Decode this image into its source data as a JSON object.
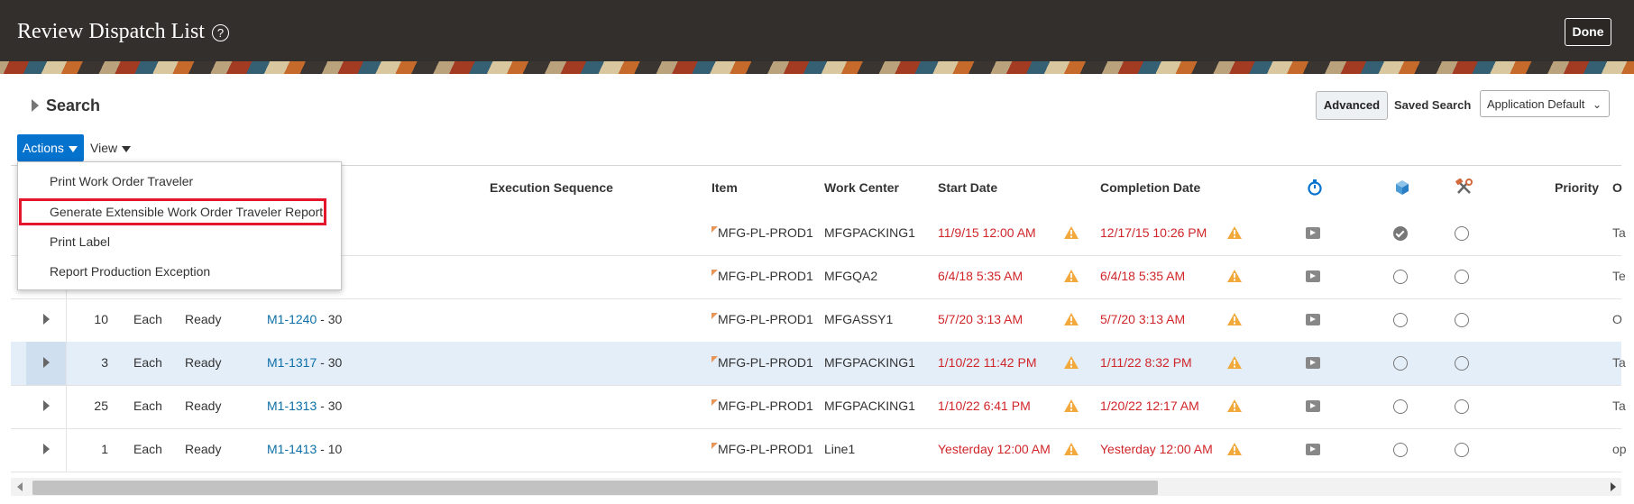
{
  "header": {
    "title": "Review Dispatch List",
    "help_glyph": "?",
    "done_label": "Done"
  },
  "search": {
    "label": "Search",
    "advanced_label": "Advanced",
    "saved_search_label": "Saved Search",
    "saved_search_value": "Application Default"
  },
  "toolbar": {
    "actions_label": "Actions",
    "view_label": "View"
  },
  "actions_menu": {
    "items": [
      "Print Work Order Traveler",
      "Generate Extensible Work Order Traveler Report",
      "Print Label",
      "Report Production Exception"
    ],
    "highlighted_index": 1,
    "highlight_color": "#e3162b"
  },
  "table": {
    "headers": {
      "execution_sequence": "Execution Sequence",
      "item": "Item",
      "work_center": "Work Center",
      "start_date": "Start Date",
      "completion_date": "Completion Date",
      "priority": "Priority",
      "last_col": "O"
    },
    "header_icons": [
      "timer-icon",
      "cube-icon",
      "tools-icon"
    ],
    "rows": [
      {
        "qty": "",
        "uom": "",
        "status": "",
        "order": "",
        "op": "",
        "item": "MFG-PL-PROD1",
        "work_center": "MFGPACKING1",
        "start": "11/9/15 12:00 AM",
        "completion": "12/17/15 10:26 PM",
        "cube": "check",
        "last": "Ta"
      },
      {
        "qty": "",
        "uom": "",
        "status": "",
        "order": "",
        "op": "",
        "item": "MFG-PL-PROD1",
        "work_center": "MFGQA2",
        "start": "6/4/18 5:35 AM",
        "completion": "6/4/18 5:35 AM",
        "cube": "empty",
        "last": "Te"
      },
      {
        "qty": "10",
        "uom": "Each",
        "status": "Ready",
        "order": "M1-1240",
        "op": " - 30",
        "item": "MFG-PL-PROD1",
        "work_center": "MFGASSY1",
        "start": "5/7/20 3:13 AM",
        "completion": "5/7/20 3:13 AM",
        "cube": "empty",
        "last": "O"
      },
      {
        "qty": "3",
        "uom": "Each",
        "status": "Ready",
        "order": "M1-1317",
        "op": " - 30",
        "item": "MFG-PL-PROD1",
        "work_center": "MFGPACKING1",
        "start": "1/10/22 11:42 PM",
        "completion": "1/11/22 8:32 PM",
        "cube": "empty",
        "last": "Ta"
      },
      {
        "qty": "25",
        "uom": "Each",
        "status": "Ready",
        "order": "M1-1313",
        "op": " - 30",
        "item": "MFG-PL-PROD1",
        "work_center": "MFGPACKING1",
        "start": "1/10/22 6:41 PM",
        "completion": "1/20/22 12:17 AM",
        "cube": "empty",
        "last": "Ta"
      },
      {
        "qty": "1",
        "uom": "Each",
        "status": "Ready",
        "order": "M1-1413",
        "op": " - 10",
        "item": "MFG-PL-PROD1",
        "work_center": "Line1",
        "start": "Yesterday 12:00 AM",
        "completion": "Yesterday 12:00 AM",
        "cube": "empty",
        "last": "op"
      }
    ],
    "selected_row_index": 3
  },
  "colors": {
    "header_bg": "#332f2c",
    "accent": "#0572ce",
    "link": "#0d6fa8",
    "late_date": "#d0262a",
    "warning": "#f2a93b",
    "selected_row": "#e4eef9"
  }
}
